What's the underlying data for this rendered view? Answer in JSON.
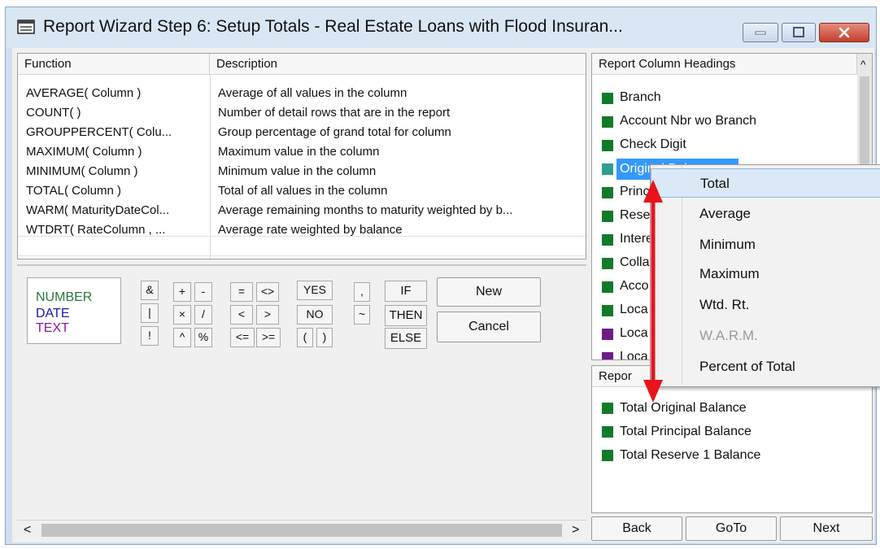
{
  "window": {
    "title": "Report Wizard Step 6:  Setup Totals - Real Estate Loans with Flood Insuran..."
  },
  "functions": {
    "headers": {
      "function": "Function",
      "description": "Description"
    },
    "rows": [
      {
        "function": "AVERAGE( Column )",
        "description": "Average of all values in the column"
      },
      {
        "function": "COUNT( )",
        "description": "Number of detail rows that are in the report"
      },
      {
        "function": "GROUPPERCENT( Colu...",
        "description": "Group percentage of grand total for column"
      },
      {
        "function": "MAXIMUM( Column )",
        "description": "Maximum value in the column"
      },
      {
        "function": "MINIMUM( Column )",
        "description": "Minimum value in the column"
      },
      {
        "function": "TOTAL( Column )",
        "description": "Total of all values in the column"
      },
      {
        "function": "WARM( MaturityDateCol...",
        "description": "Average remaining months to maturity weighted by b..."
      },
      {
        "function": "WTDRT( RateColumn , ...",
        "description": "Average rate weighted by balance"
      }
    ]
  },
  "legend": {
    "number": "NUMBER",
    "date": "DATE",
    "text": "TEXT"
  },
  "legend_colors": {
    "number": "#2a7a39",
    "date": "#1a1aa8",
    "text": "#8a1aa0"
  },
  "operators": {
    "amp": "&",
    "pipe": "|",
    "bang": "!",
    "plus": "+",
    "minus": "-",
    "times": "×",
    "divide": "/",
    "caret": "^",
    "percent": "%",
    "eq": "=",
    "ne": "<>",
    "lt": "<",
    "gt": ">",
    "le": "<=",
    "ge": ">=",
    "yes": "YES",
    "no": "NO",
    "lparen": "(",
    "rparen": ")",
    "comma": ",",
    "tilde": "~",
    "if": "IF",
    "then": "THEN",
    "else": "ELSE"
  },
  "buttons": {
    "new": "New",
    "cancel": "Cancel",
    "back": "Back",
    "goto": "GoTo",
    "next": "Next"
  },
  "column_headings": {
    "header": "Report Column Headings",
    "items": [
      {
        "label": "Branch",
        "color": "green"
      },
      {
        "label": "Account Nbr wo Branch",
        "color": "green"
      },
      {
        "label": "Check Digit",
        "color": "green"
      },
      {
        "label": "Original Balance",
        "color": "teal",
        "selected": true
      },
      {
        "label": "Princi",
        "color": "green"
      },
      {
        "label": "Rese",
        "color": "green"
      },
      {
        "label": "Intere",
        "color": "green"
      },
      {
        "label": "Collat",
        "color": "green"
      },
      {
        "label": "Acco",
        "color": "green"
      },
      {
        "label": "Loca",
        "color": "green"
      },
      {
        "label": "Loca",
        "color": "purple"
      },
      {
        "label": "Loca",
        "color": "purple"
      }
    ]
  },
  "report_totals": {
    "header": "Repor",
    "items": [
      "Total Original Balance",
      "Total Principal Balance",
      "Total Reserve 1 Balance"
    ]
  },
  "context_menu": {
    "items": [
      {
        "label": "Total",
        "highlighted": true
      },
      {
        "label": "Average"
      },
      {
        "label": "Minimum"
      },
      {
        "label": "Maximum"
      },
      {
        "label": "Wtd. Rt."
      },
      {
        "label": "W.A.R.M.",
        "disabled": true
      },
      {
        "label": "Percent of Total"
      }
    ]
  },
  "scroll": {
    "left_arrow": "<",
    "right_arrow": ">",
    "up_arrow": "^"
  },
  "annotation_color": "#e8141c"
}
